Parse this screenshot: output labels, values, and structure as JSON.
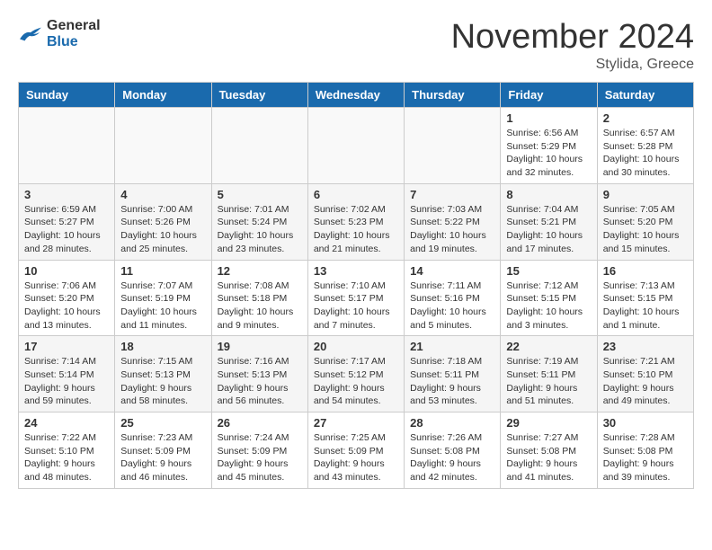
{
  "header": {
    "logo_general": "General",
    "logo_blue": "Blue",
    "month": "November 2024",
    "location": "Stylida, Greece"
  },
  "weekdays": [
    "Sunday",
    "Monday",
    "Tuesday",
    "Wednesday",
    "Thursday",
    "Friday",
    "Saturday"
  ],
  "weeks": [
    [
      {
        "day": "",
        "empty": true
      },
      {
        "day": "",
        "empty": true
      },
      {
        "day": "",
        "empty": true
      },
      {
        "day": "",
        "empty": true
      },
      {
        "day": "",
        "empty": true
      },
      {
        "day": "1",
        "info": "Sunrise: 6:56 AM\nSunset: 5:29 PM\nDaylight: 10 hours\nand 32 minutes."
      },
      {
        "day": "2",
        "info": "Sunrise: 6:57 AM\nSunset: 5:28 PM\nDaylight: 10 hours\nand 30 minutes."
      }
    ],
    [
      {
        "day": "3",
        "info": "Sunrise: 6:59 AM\nSunset: 5:27 PM\nDaylight: 10 hours\nand 28 minutes."
      },
      {
        "day": "4",
        "info": "Sunrise: 7:00 AM\nSunset: 5:26 PM\nDaylight: 10 hours\nand 25 minutes."
      },
      {
        "day": "5",
        "info": "Sunrise: 7:01 AM\nSunset: 5:24 PM\nDaylight: 10 hours\nand 23 minutes."
      },
      {
        "day": "6",
        "info": "Sunrise: 7:02 AM\nSunset: 5:23 PM\nDaylight: 10 hours\nand 21 minutes."
      },
      {
        "day": "7",
        "info": "Sunrise: 7:03 AM\nSunset: 5:22 PM\nDaylight: 10 hours\nand 19 minutes."
      },
      {
        "day": "8",
        "info": "Sunrise: 7:04 AM\nSunset: 5:21 PM\nDaylight: 10 hours\nand 17 minutes."
      },
      {
        "day": "9",
        "info": "Sunrise: 7:05 AM\nSunset: 5:20 PM\nDaylight: 10 hours\nand 15 minutes."
      }
    ],
    [
      {
        "day": "10",
        "info": "Sunrise: 7:06 AM\nSunset: 5:20 PM\nDaylight: 10 hours\nand 13 minutes."
      },
      {
        "day": "11",
        "info": "Sunrise: 7:07 AM\nSunset: 5:19 PM\nDaylight: 10 hours\nand 11 minutes."
      },
      {
        "day": "12",
        "info": "Sunrise: 7:08 AM\nSunset: 5:18 PM\nDaylight: 10 hours\nand 9 minutes."
      },
      {
        "day": "13",
        "info": "Sunrise: 7:10 AM\nSunset: 5:17 PM\nDaylight: 10 hours\nand 7 minutes."
      },
      {
        "day": "14",
        "info": "Sunrise: 7:11 AM\nSunset: 5:16 PM\nDaylight: 10 hours\nand 5 minutes."
      },
      {
        "day": "15",
        "info": "Sunrise: 7:12 AM\nSunset: 5:15 PM\nDaylight: 10 hours\nand 3 minutes."
      },
      {
        "day": "16",
        "info": "Sunrise: 7:13 AM\nSunset: 5:15 PM\nDaylight: 10 hours\nand 1 minute."
      }
    ],
    [
      {
        "day": "17",
        "info": "Sunrise: 7:14 AM\nSunset: 5:14 PM\nDaylight: 9 hours\nand 59 minutes."
      },
      {
        "day": "18",
        "info": "Sunrise: 7:15 AM\nSunset: 5:13 PM\nDaylight: 9 hours\nand 58 minutes."
      },
      {
        "day": "19",
        "info": "Sunrise: 7:16 AM\nSunset: 5:13 PM\nDaylight: 9 hours\nand 56 minutes."
      },
      {
        "day": "20",
        "info": "Sunrise: 7:17 AM\nSunset: 5:12 PM\nDaylight: 9 hours\nand 54 minutes."
      },
      {
        "day": "21",
        "info": "Sunrise: 7:18 AM\nSunset: 5:11 PM\nDaylight: 9 hours\nand 53 minutes."
      },
      {
        "day": "22",
        "info": "Sunrise: 7:19 AM\nSunset: 5:11 PM\nDaylight: 9 hours\nand 51 minutes."
      },
      {
        "day": "23",
        "info": "Sunrise: 7:21 AM\nSunset: 5:10 PM\nDaylight: 9 hours\nand 49 minutes."
      }
    ],
    [
      {
        "day": "24",
        "info": "Sunrise: 7:22 AM\nSunset: 5:10 PM\nDaylight: 9 hours\nand 48 minutes."
      },
      {
        "day": "25",
        "info": "Sunrise: 7:23 AM\nSunset: 5:09 PM\nDaylight: 9 hours\nand 46 minutes."
      },
      {
        "day": "26",
        "info": "Sunrise: 7:24 AM\nSunset: 5:09 PM\nDaylight: 9 hours\nand 45 minutes."
      },
      {
        "day": "27",
        "info": "Sunrise: 7:25 AM\nSunset: 5:09 PM\nDaylight: 9 hours\nand 43 minutes."
      },
      {
        "day": "28",
        "info": "Sunrise: 7:26 AM\nSunset: 5:08 PM\nDaylight: 9 hours\nand 42 minutes."
      },
      {
        "day": "29",
        "info": "Sunrise: 7:27 AM\nSunset: 5:08 PM\nDaylight: 9 hours\nand 41 minutes."
      },
      {
        "day": "30",
        "info": "Sunrise: 7:28 AM\nSunset: 5:08 PM\nDaylight: 9 hours\nand 39 minutes."
      }
    ]
  ]
}
